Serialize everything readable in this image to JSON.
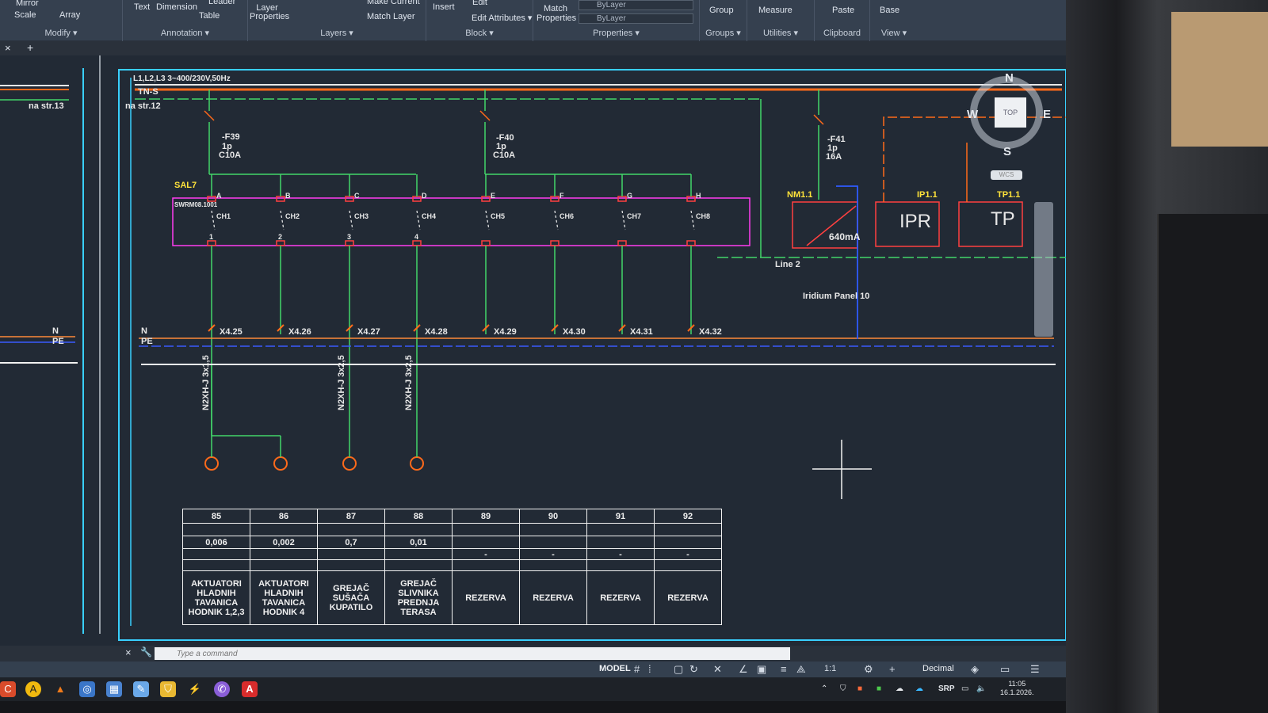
{
  "ribbon": {
    "modify": {
      "mirror": "Mirror",
      "scale": "Scale",
      "array": "Array",
      "label": "Modify ▾"
    },
    "annotation": {
      "text": "Text",
      "dimension": "Dimension",
      "leader": "Leader",
      "table": "Table",
      "label": "Annotation ▾"
    },
    "layers": {
      "layer_properties": "Layer Properties",
      "make_current": "Make Current",
      "match_layer": "Match Layer",
      "label": "Layers ▾"
    },
    "block": {
      "insert": "Insert",
      "edit": "Edit",
      "edit_attributes": "Edit Attributes ▾",
      "label": "Block ▾"
    },
    "properties": {
      "match_properties": "Match Properties",
      "bylayer_1": "ByLayer",
      "bylayer_2": "ByLayer",
      "label": "Properties ▾"
    },
    "groups": {
      "group": "Group",
      "label": "Groups ▾"
    },
    "utilities": {
      "measure": "Measure",
      "label": "Utilities ▾"
    },
    "clipboard": {
      "paste": "Paste",
      "label": "Clipboard"
    },
    "view": {
      "base": "Base",
      "label": "View ▾"
    }
  },
  "doctabs": {
    "close": "×",
    "add": "+"
  },
  "drawing": {
    "left_ref": "na str.13",
    "page_ref": "na str.12",
    "supply": "L1,L2,L3 3~400/230V,50Hz",
    "net_type": "TN-S",
    "breakers": [
      {
        "id": "-F39",
        "poles": "1p",
        "rating": "C10A"
      },
      {
        "id": "-F40",
        "poles": "1p",
        "rating": "C10A"
      },
      {
        "id": "-F41",
        "poles": "1p",
        "rating": "16A"
      }
    ],
    "module": "SAL7",
    "module_sub": "SWRM08.1001",
    "channels": [
      "CH1",
      "CH2",
      "CH3",
      "CH4",
      "CH5",
      "CH6",
      "CH7",
      "CH8"
    ],
    "inputs": [
      "A",
      "B",
      "C",
      "D",
      "E",
      "F",
      "G",
      "H"
    ],
    "ch_letters": [
      "1",
      "2",
      "3",
      "4"
    ],
    "devices": [
      {
        "tag": "NM1.1",
        "text": "640mA"
      },
      {
        "tag": "IP1.1",
        "text": "IPR"
      },
      {
        "tag": "TP1.1",
        "text": "TP"
      }
    ],
    "bus": "Line 2",
    "panel": "Iridium Panel 10",
    "n_label": "N",
    "pe_label": "PE",
    "terminals": [
      "X4.25",
      "X4.26",
      "X4.27",
      "X4.28",
      "X4.29",
      "X4.30",
      "X4.31",
      "X4.32"
    ],
    "cables": [
      "N2XH-J 3x1,5",
      "N2XH-J 3x2,5",
      "N2XH-J 3x2,5"
    ]
  },
  "table": {
    "headers": [
      "85",
      "86",
      "87",
      "88",
      "89",
      "90",
      "91",
      "92"
    ],
    "power": [
      "0,006",
      "0,002",
      "0,7",
      "0,01",
      "",
      "",
      "",
      ""
    ],
    "dash": [
      "",
      "",
      "",
      "",
      "-",
      "-",
      "-",
      "-"
    ],
    "desc": [
      "AKTUATORI HLADNIH TAVANICA HODNIK 1,2,3",
      "AKTUATORI HLADNIH TAVANICA HODNIK 4",
      "GREJAČ SUŠAČA KUPATILO",
      "GREJAČ SLIVNIKA PREDNJA TERASA",
      "REZERVA",
      "REZERVA",
      "REZERVA",
      "REZERVA"
    ]
  },
  "viewcube": {
    "top": "TOP",
    "n": "N",
    "s": "S",
    "w": "W",
    "e": "E",
    "wcs": "WCS"
  },
  "command": {
    "placeholder": "Type a command"
  },
  "status": {
    "model": "MODEL",
    "scale": "1:1",
    "units": "Decimal"
  },
  "taskbar": {
    "lang": "SRP",
    "time": "11:05",
    "date": "16.1.2026."
  }
}
